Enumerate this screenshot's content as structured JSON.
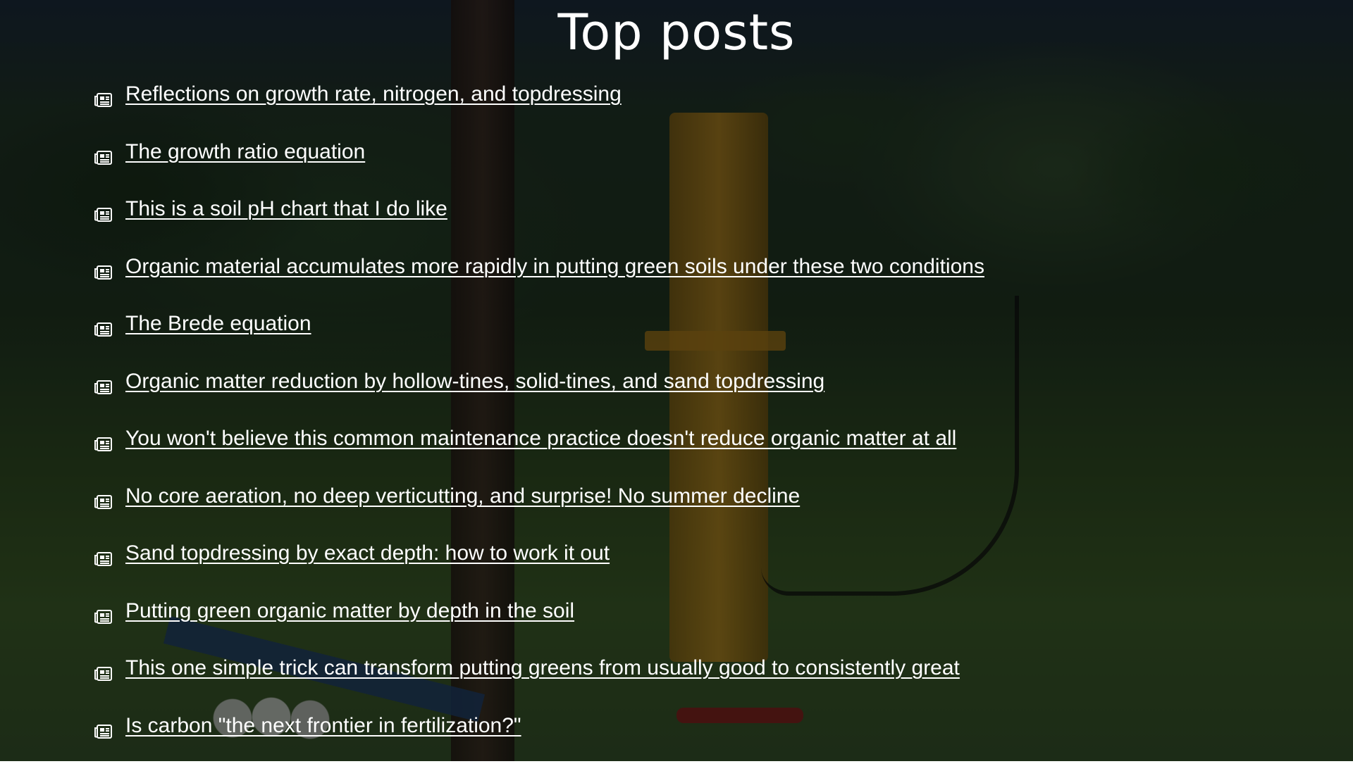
{
  "page": {
    "title": "Top posts",
    "icon_name": "newspaper-icon",
    "text_color": "#ffffff"
  },
  "posts": [
    {
      "label": "Reflections on growth rate, nitrogen, and topdressing"
    },
    {
      "label": "The growth ratio equation"
    },
    {
      "label": "This is a soil pH chart that I do like"
    },
    {
      "label": "Organic material accumulates more rapidly in putting green soils under these two conditions"
    },
    {
      "label": "The Brede equation"
    },
    {
      "label": "Organic matter reduction by hollow-tines, solid-tines, and sand topdressing"
    },
    {
      "label": "You won't believe this common maintenance practice doesn't reduce organic matter at all"
    },
    {
      "label": "No core aeration, no deep verticutting, and surprise! No summer decline"
    },
    {
      "label": "Sand topdressing by exact depth: how to work it out"
    },
    {
      "label": "Putting green organic matter by depth in the soil"
    },
    {
      "label": "This one simple trick can transform putting greens from usually good to consistently great"
    },
    {
      "label": "Is carbon \"the next frontier in fertilization?\""
    }
  ]
}
